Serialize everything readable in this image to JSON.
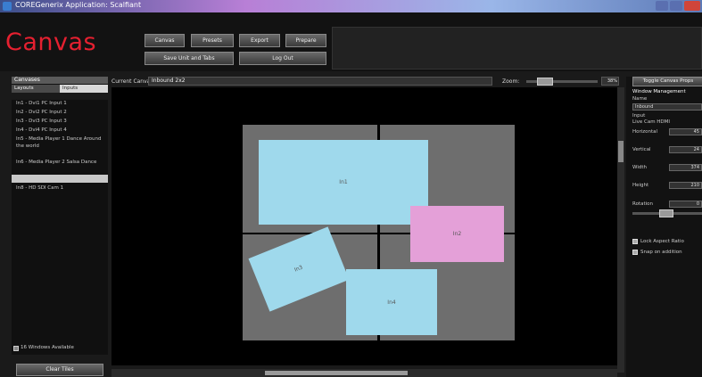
{
  "window": {
    "title": "COREGenerix Application: Scalfiant"
  },
  "header": {
    "app_title": "Canvas",
    "buttons": [
      "Canvas",
      "Presets",
      "Export",
      "Prepare",
      "Save Unit and Tabs",
      "Log Out"
    ]
  },
  "left_panel": {
    "section_label": "Canvases",
    "tabs": [
      "Layouts",
      "Inputs"
    ],
    "items": [
      "In1 - Dvi1 PC Input 1",
      "In2 - Dvi2 PC Input 2",
      "In3 - Dvi3 PC Input 3",
      "In4 - Dvi4 PC Input 4",
      "In5 - Media Player 1 Dance Around the world",
      "In6 - Media Player 2 Salsa Dance",
      "",
      "In8 - HD SDI Cam 1"
    ],
    "windows_available": "16 Windows Available",
    "clear_button": "Clear Tiles"
  },
  "toolbar": {
    "current_canvas_label": "Current Canvas:",
    "current_canvas_value": "Inbound 2x2",
    "zoom_label": "Zoom:",
    "zoom_value": "38%",
    "zoom_level": 0.2,
    "canvas_props_button": "Toggle Canvas Props"
  },
  "canvas": {
    "window_labels": [
      "In1",
      "In2",
      "In3",
      "In4"
    ]
  },
  "right_panel": {
    "section_title": "Window Management",
    "name_label": "Name",
    "name_value": "Inbound",
    "input_label": "Input",
    "input_value": "Live Cam HDMI",
    "horizontal_label": "Horizontal",
    "horizontal_value": "45",
    "vertical_label": "Vertical",
    "vertical_value": "24",
    "width_label": "Width",
    "width_value": "374",
    "height_label": "Height",
    "height_value": "210",
    "rotation_label": "Rotation",
    "rotation_value": "0",
    "lock_aspect_label": "Lock Aspect Ratio",
    "snap_label": "Snap on addition"
  }
}
